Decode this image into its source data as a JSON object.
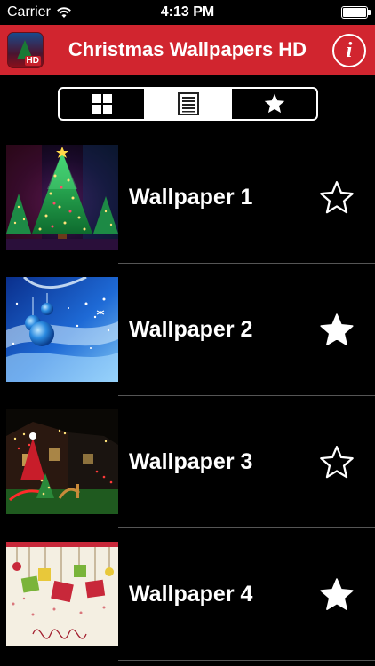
{
  "status_bar": {
    "carrier": "Carrier",
    "time": "4:13 PM"
  },
  "header": {
    "title": "Christmas Wallpapers HD",
    "app_icon_badge": "HD",
    "info_glyph": "i",
    "color": "#d1252f"
  },
  "tabs": [
    {
      "icon": "grid-icon",
      "selected": false
    },
    {
      "icon": "list-icon",
      "selected": true
    },
    {
      "icon": "star-icon",
      "selected": false
    }
  ],
  "wallpapers": [
    {
      "label": "Wallpaper 1",
      "favorite": false
    },
    {
      "label": "Wallpaper 2",
      "favorite": true
    },
    {
      "label": "Wallpaper 3",
      "favorite": false
    },
    {
      "label": "Wallpaper 4",
      "favorite": true
    }
  ]
}
